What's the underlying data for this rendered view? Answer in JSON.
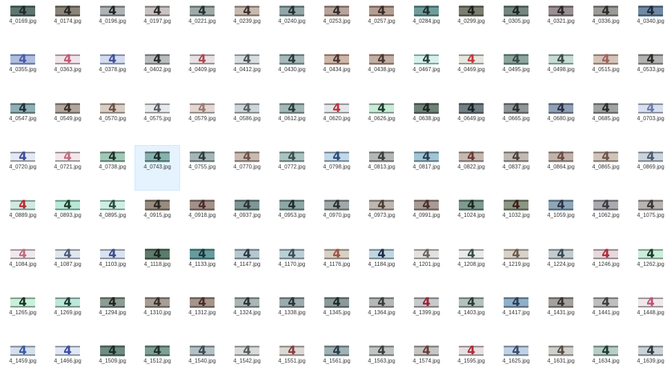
{
  "selected_file": "4_0743.jpg",
  "thumbnail_glyph": "4",
  "files": [
    "4_0169.jpg",
    "4_0174.jpg",
    "4_0196.jpg",
    "4_0197.jpg",
    "4_0221.jpg",
    "4_0239.jpg",
    "4_0240.jpg",
    "4_0253.jpg",
    "4_0257.jpg",
    "4_0284.jpg",
    "4_0299.jpg",
    "4_0305.jpg",
    "4_0321.jpg",
    "4_0336.jpg",
    "4_0340.jpg",
    "4_0355.jpg",
    "4_0363.jpg",
    "4_0378.jpg",
    "4_0402.jpg",
    "4_0409.jpg",
    "4_0412.jpg",
    "4_0430.jpg",
    "4_0434.jpg",
    "4_0438.jpg",
    "4_0467.jpg",
    "4_0469.jpg",
    "4_0495.jpg",
    "4_0498.jpg",
    "4_0515.jpg",
    "4_0533.jpg",
    "4_0547.jpg",
    "4_0549.jpg",
    "4_0570.jpg",
    "4_0575.jpg",
    "4_0579.jpg",
    "4_0586.jpg",
    "4_0612.jpg",
    "4_0620.jpg",
    "4_0626.jpg",
    "4_0638.jpg",
    "4_0649.jpg",
    "4_0665.jpg",
    "4_0680.jpg",
    "4_0685.jpg",
    "4_0703.jpg",
    "4_0720.jpg",
    "4_0721.jpg",
    "4_0738.jpg",
    "4_0743.jpg",
    "4_0755.jpg",
    "4_0770.jpg",
    "4_0772.jpg",
    "4_0798.jpg",
    "4_0813.jpg",
    "4_0817.jpg",
    "4_0822.jpg",
    "4_0837.jpg",
    "4_0864.jpg",
    "4_0865.jpg",
    "4_0869.jpg",
    "4_0889.jpg",
    "4_0893.jpg",
    "4_0895.jpg",
    "4_0915.jpg",
    "4_0918.jpg",
    "4_0937.jpg",
    "4_0953.jpg",
    "4_0970.jpg",
    "4_0973.jpg",
    "4_0991.jpg",
    "4_1024.jpg",
    "4_1032.jpg",
    "4_1059.jpg",
    "4_1062.jpg",
    "4_1075.jpg",
    "4_1084.jpg",
    "4_1087.jpg",
    "4_1103.jpg",
    "4_1118.jpg",
    "4_1133.jpg",
    "4_1147.jpg",
    "4_1170.jpg",
    "4_1176.jpg",
    "4_1184.jpg",
    "4_1201.jpg",
    "4_1208.jpg",
    "4_1219.jpg",
    "4_1224.jpg",
    "4_1246.jpg",
    "4_1262.jpg",
    "4_1265.jpg",
    "4_1269.jpg",
    "4_1294.jpg",
    "4_1310.jpg",
    "4_1312.jpg",
    "4_1324.jpg",
    "4_1338.jpg",
    "4_1345.jpg",
    "4_1364.jpg",
    "4_1399.jpg",
    "4_1403.jpg",
    "4_1417.jpg",
    "4_1431.jpg",
    "4_1441.jpg",
    "4_1448.jpg",
    "4_1459.jpg",
    "4_1466.jpg",
    "4_1509.jpg",
    "4_1512.jpg",
    "4_1540.jpg",
    "4_1542.jpg",
    "4_1551.jpg",
    "4_1561.jpg",
    "4_1563.jpg",
    "4_1574.jpg",
    "4_1595.jpg",
    "4_1625.jpg",
    "4_1631.jpg",
    "4_1634.jpg",
    "4_1639.jpg"
  ],
  "thumb_colors": [
    "#5f7570",
    "#8b8478",
    "#aeb3b5",
    "#c9c2c2",
    "#9eaaa8",
    "#c7b9ae",
    "#92a6a8",
    "#b7a39a",
    "#b69d92",
    "#6f9d9b",
    "#7b7f70",
    "#738680",
    "#9a8f93",
    "#9b9a97",
    "#6f89a4",
    "#aebde0",
    "#f1e3ea",
    "#d2dbef",
    "#b8bcbd",
    "#e7e1e4",
    "#d8dddf",
    "#a7b9ba",
    "#cdb6a8",
    "#c2aea4",
    "#d7f0ec",
    "#e4e8e0",
    "#8ba49d",
    "#c8dcd6",
    "#d5c3b8",
    "#b2b3b0",
    "#8eafb6",
    "#b2a59c",
    "#d9ccc2",
    "#e6e9ec",
    "#e4d7d2",
    "#cdd5d9",
    "#a2b8b8",
    "#e2e7ea",
    "#c6ecd6",
    "#6e8378",
    "#6f7f84",
    "#8f9698",
    "#8ea0b8",
    "#9fa3a3",
    "#d6dff0",
    "#e3e8f5",
    "#f5e6ec",
    "#9fc9b6",
    "#86b2ae",
    "#a4b6b8",
    "#cab9b0",
    "#a9c3c3",
    "#bfd8ea",
    "#b3b7b5",
    "#9fc5d7",
    "#c7b8ae",
    "#bfb9b2",
    "#c2b2a9",
    "#d2c3b8",
    "#c9d4de",
    "#cfe9e1",
    "#b8e8d8",
    "#cdeee4",
    "#978c80",
    "#a29189",
    "#7f9696",
    "#8ea7a5",
    "#a1a9a8",
    "#bfb6b0",
    "#a89b95",
    "#7d9b8e",
    "#8b9683",
    "#8ea6b9",
    "#a9aab0",
    "#b7b3b1",
    "#f1e8ee",
    "#dfe7ef",
    "#d8e2f0",
    "#5d7b6c",
    "#669c9f",
    "#b6c8cf",
    "#b9cfd6",
    "#d7d0c3",
    "#bfd6e2",
    "#e3e1de",
    "#e6ece8",
    "#d7d1c8",
    "#c2ccd0",
    "#e6d8dc",
    "#c9eedb",
    "#c6f2d9",
    "#bce8dc",
    "#8c9d94",
    "#a79d95",
    "#a7948b",
    "#a9b6b6",
    "#9aacae",
    "#8a9a9a",
    "#b4b8b6",
    "#c6cacd",
    "#b2c3bd",
    "#8fb0c9",
    "#a5a29e",
    "#bebfbd",
    "#efe7ec",
    "#d3e0ed",
    "#dfe8f4",
    "#6d8c82",
    "#7da093",
    "#b3c1c5",
    "#d6dbdc",
    "#dcd8d4",
    "#9fb2b8",
    "#c1c4c4",
    "#c5c5c2",
    "#e8dfe2",
    "#bdd2e5",
    "#cfcfcc",
    "#b6cec6",
    "#c9d3d7"
  ],
  "glyph_colors": [
    "#1f2a2a",
    "#262626",
    "#222222",
    "#2a2a2a",
    "#233030",
    "#3a302c",
    "#25302f",
    "#33292a",
    "#3a2b28",
    "#1f3230",
    "#1e1e1a",
    "#1d2424",
    "#2d2526",
    "#2a2a2a",
    "#1f2a3a",
    "#4a5aa8",
    "#c45670",
    "#3d4f9a",
    "#2a2c2c",
    "#b0454f",
    "#4b5256",
    "#2a3a3a",
    "#4a3530",
    "#4a3630",
    "#2a4040",
    "#c23a38",
    "#3a4a45",
    "#3c4a46",
    "#a0605a",
    "#2a2a2a",
    "#1f3038",
    "#3a302a",
    "#6a5040",
    "#5a5f65",
    "#9a7a70",
    "#556068",
    "#2a3a3a",
    "#c0303a",
    "#1e3a2a",
    "#1a2420",
    "#1a2224",
    "#2a2e30",
    "#2a3040",
    "#2a2c2c",
    "#6a7aa8",
    "#3a4a9a",
    "#c06a80",
    "#1e3028",
    "#1a2a2a",
    "#2a3a3a",
    "#6a5048",
    "#3a4c4c",
    "#2a4a7a",
    "#3a3c3c",
    "#2a4050",
    "#6a3a34",
    "#4a4038",
    "#6a4a40",
    "#6a5248",
    "#4a5a6a",
    "#b82a30",
    "#1e3a2a",
    "#2a4a3a",
    "#2a2620",
    "#4a2a26",
    "#2a3434",
    "#1e2e2e",
    "#2a3030",
    "#4a3a34",
    "#4a2e2a",
    "#1e2a24",
    "#3a1e14",
    "#2a3444",
    "#3a3a3e",
    "#3a3434",
    "#c06a80",
    "#4a5a78",
    "#3a4a8a",
    "#1a2620",
    "#1a3438",
    "#2a3a44",
    "#3a4c58",
    "#a05040",
    "#1a2a44",
    "#6a6460",
    "#3a4a46",
    "#6a5848",
    "#3a4650",
    "#b02a38",
    "#1e3a2a",
    "#1a3022",
    "#1e3a30",
    "#1a2420",
    "#3a302a",
    "#4a2a26",
    "#2a3434",
    "#2a3434",
    "#1e2a2a",
    "#3a3a3a",
    "#a02030",
    "#2a3a3a",
    "#2a3a5a",
    "#3a3030",
    "#3a3c3c",
    "#c05070",
    "#3a5aa8",
    "#3a4aa8",
    "#1a2a24",
    "#1e3030",
    "#3a4a50",
    "#5a5a5a",
    "#8a3a3a",
    "#2a3a44",
    "#3a3e3e",
    "#6a3a3a",
    "#b02a38",
    "#3a4a6a",
    "#5a4a40",
    "#1e3a30",
    "#2a3a40"
  ]
}
